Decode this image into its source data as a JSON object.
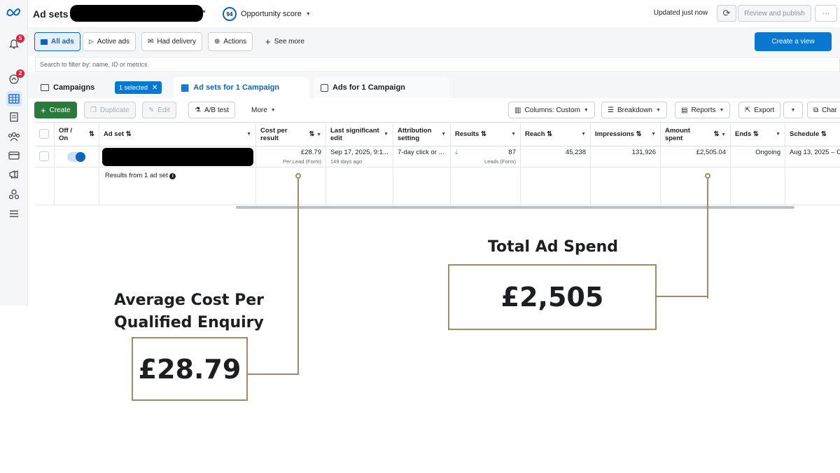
{
  "topbar": {
    "title": "Ad sets",
    "opportunity_score_value": "94",
    "opportunity_score_label": "Opportunity score",
    "updated": "Updated just now",
    "review_publish": "Review and publish",
    "more": "···"
  },
  "rail": {
    "notifications_badge": "5",
    "account_badge": "2"
  },
  "filters": {
    "items": [
      "All ads",
      "Active ads",
      "Had delivery",
      "Actions"
    ],
    "see_more": "See more",
    "create_view": "Create a view"
  },
  "search": {
    "placeholder": "Search to filter by: name, ID or metrics"
  },
  "tabs": {
    "campaigns": "Campaigns",
    "selected_chip": "1 selected",
    "ad_sets": "Ad sets for 1 Campaign",
    "ads": "Ads for 1 Campaign"
  },
  "actions": {
    "create": "Create",
    "duplicate": "Duplicate",
    "edit": "Edit",
    "ab_test": "A/B test",
    "more": "More",
    "columns": "Columns: Custom",
    "breakdown": "Breakdown",
    "reports": "Reports",
    "export": "Export",
    "charts": "Char"
  },
  "table": {
    "headers": {
      "off_on": "Off / On",
      "ad_set": "Ad set",
      "cost_per_result": "Cost per result",
      "last_edit": "Last significant edit",
      "attribution": "Attribution setting",
      "results": "Results",
      "reach": "Reach",
      "impressions": "Impressions",
      "amount_spent": "Amount spent",
      "ends": "Ends",
      "schedule": "Schedule"
    },
    "row": {
      "cost_per_result": "£28.79",
      "cost_per_result_sub": "Per Lead (Form)",
      "last_edit": "Sep 17, 2025, 9:1...",
      "last_edit_sub": "149 days ago",
      "attribution": "7-day click or ...",
      "results": "87",
      "results_sub": "Leads (Form)",
      "reach": "45,238",
      "impressions": "131,926",
      "amount_spent": "£2,505.04",
      "ends": "Ongoing",
      "schedule": "Aug 13, 2025 – O"
    },
    "summary": "Results from 1 ad set"
  },
  "annotations": {
    "cpq_title_line1": "Average Cost Per",
    "cpq_title_line2": "Qualified Enquiry",
    "cpq_value": "£28.79",
    "spend_title": "Total Ad Spend",
    "spend_value": "£2,505"
  },
  "colors": {
    "accent": "#0a66c2",
    "create_green": "#2b7a3d",
    "annotation_gold": "#a28a62"
  }
}
